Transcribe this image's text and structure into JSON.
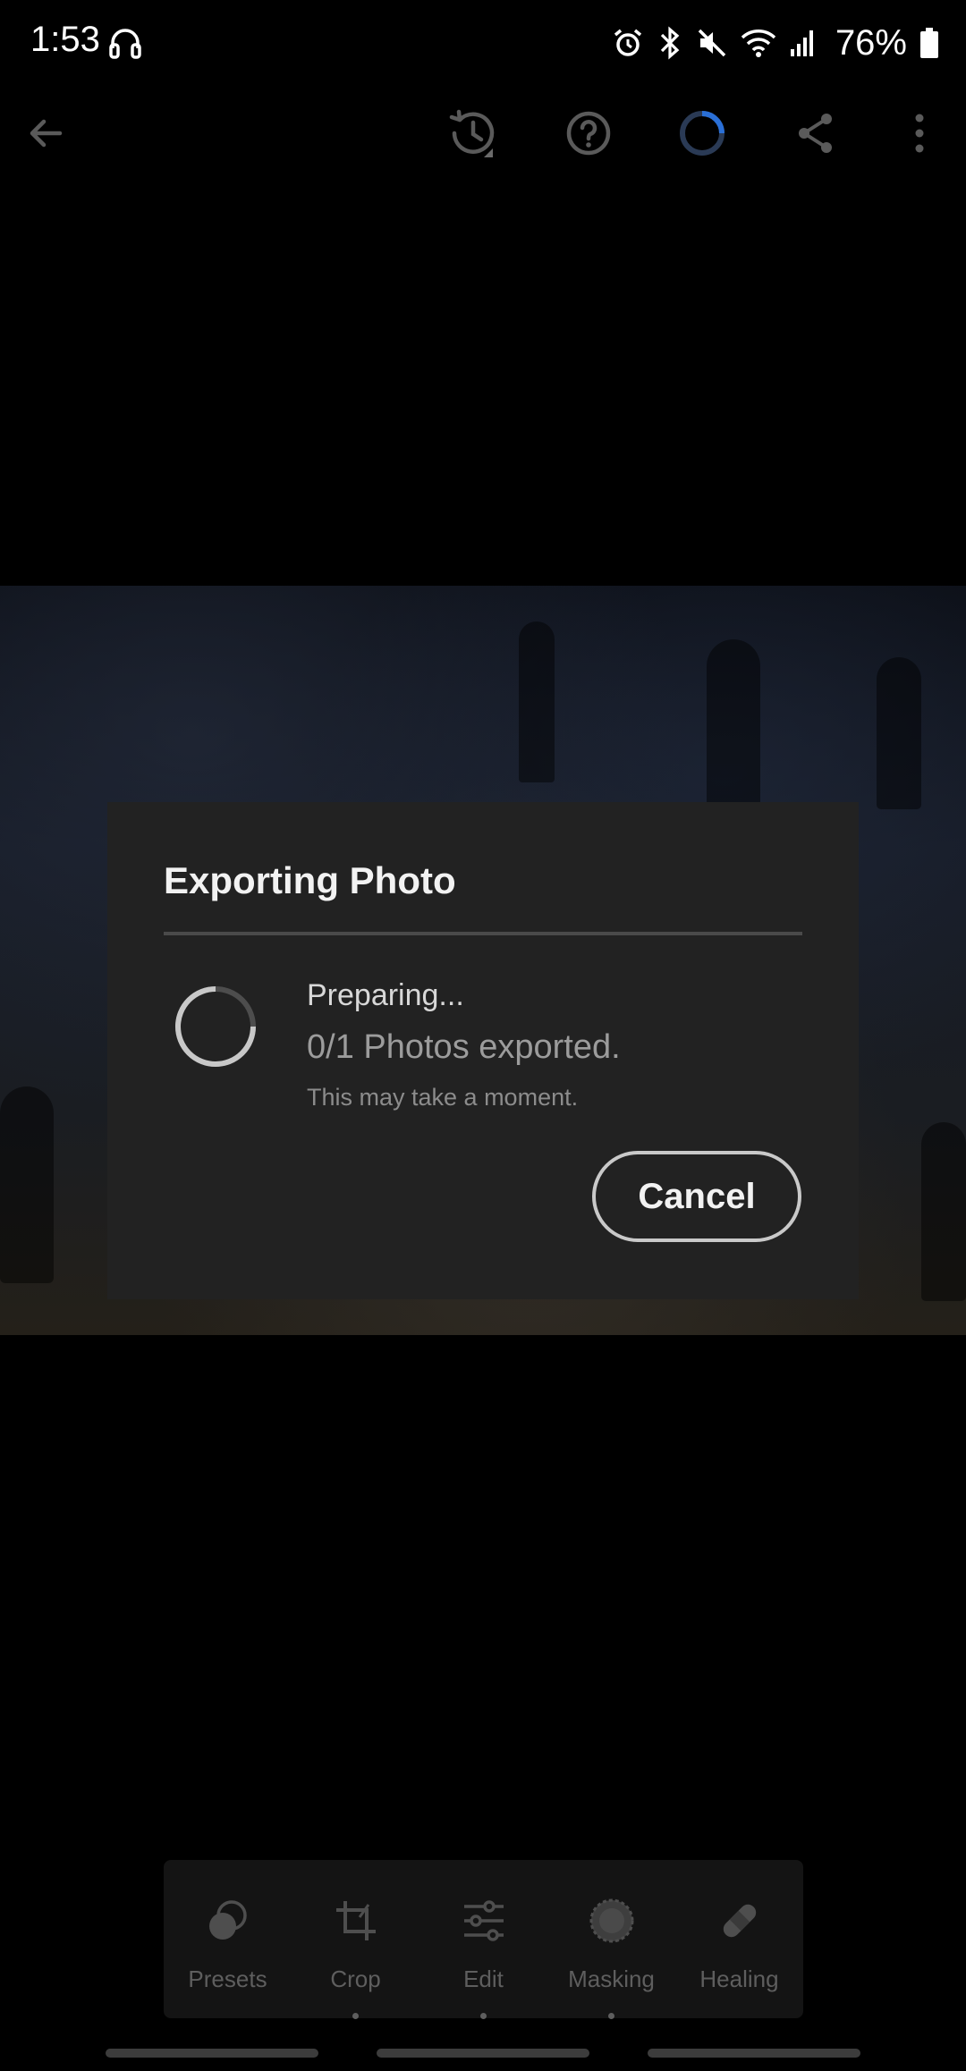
{
  "status_bar": {
    "time": "1:53",
    "battery": "76%",
    "icons": [
      "headphones-icon",
      "alarm-icon",
      "bluetooth-icon",
      "mute-icon",
      "wifi-icon",
      "signal-icon",
      "battery-icon"
    ]
  },
  "toolbar": {
    "icons": [
      "back-arrow-icon",
      "history-icon",
      "help-icon",
      "sync-progress-icon",
      "share-icon",
      "more-options-icon"
    ]
  },
  "dialog": {
    "title": "Exporting Photo",
    "status": "Preparing...",
    "progress_text": "0/1 Photos exported.",
    "note": "This may take a moment.",
    "cancel_label": "Cancel"
  },
  "tools": {
    "items": [
      {
        "label": "Presets",
        "icon": "presets-icon"
      },
      {
        "label": "Crop",
        "icon": "crop-icon"
      },
      {
        "label": "Edit",
        "icon": "edit-sliders-icon"
      },
      {
        "label": "Masking",
        "icon": "masking-icon"
      },
      {
        "label": "Healing",
        "icon": "healing-icon"
      }
    ]
  },
  "colors": {
    "background": "#000000",
    "dialog_background": "#222222",
    "accent_blue": "#2a6fd6",
    "toolbar_icon": "#5a5a5a",
    "tool_label": "#5e5e5e"
  }
}
